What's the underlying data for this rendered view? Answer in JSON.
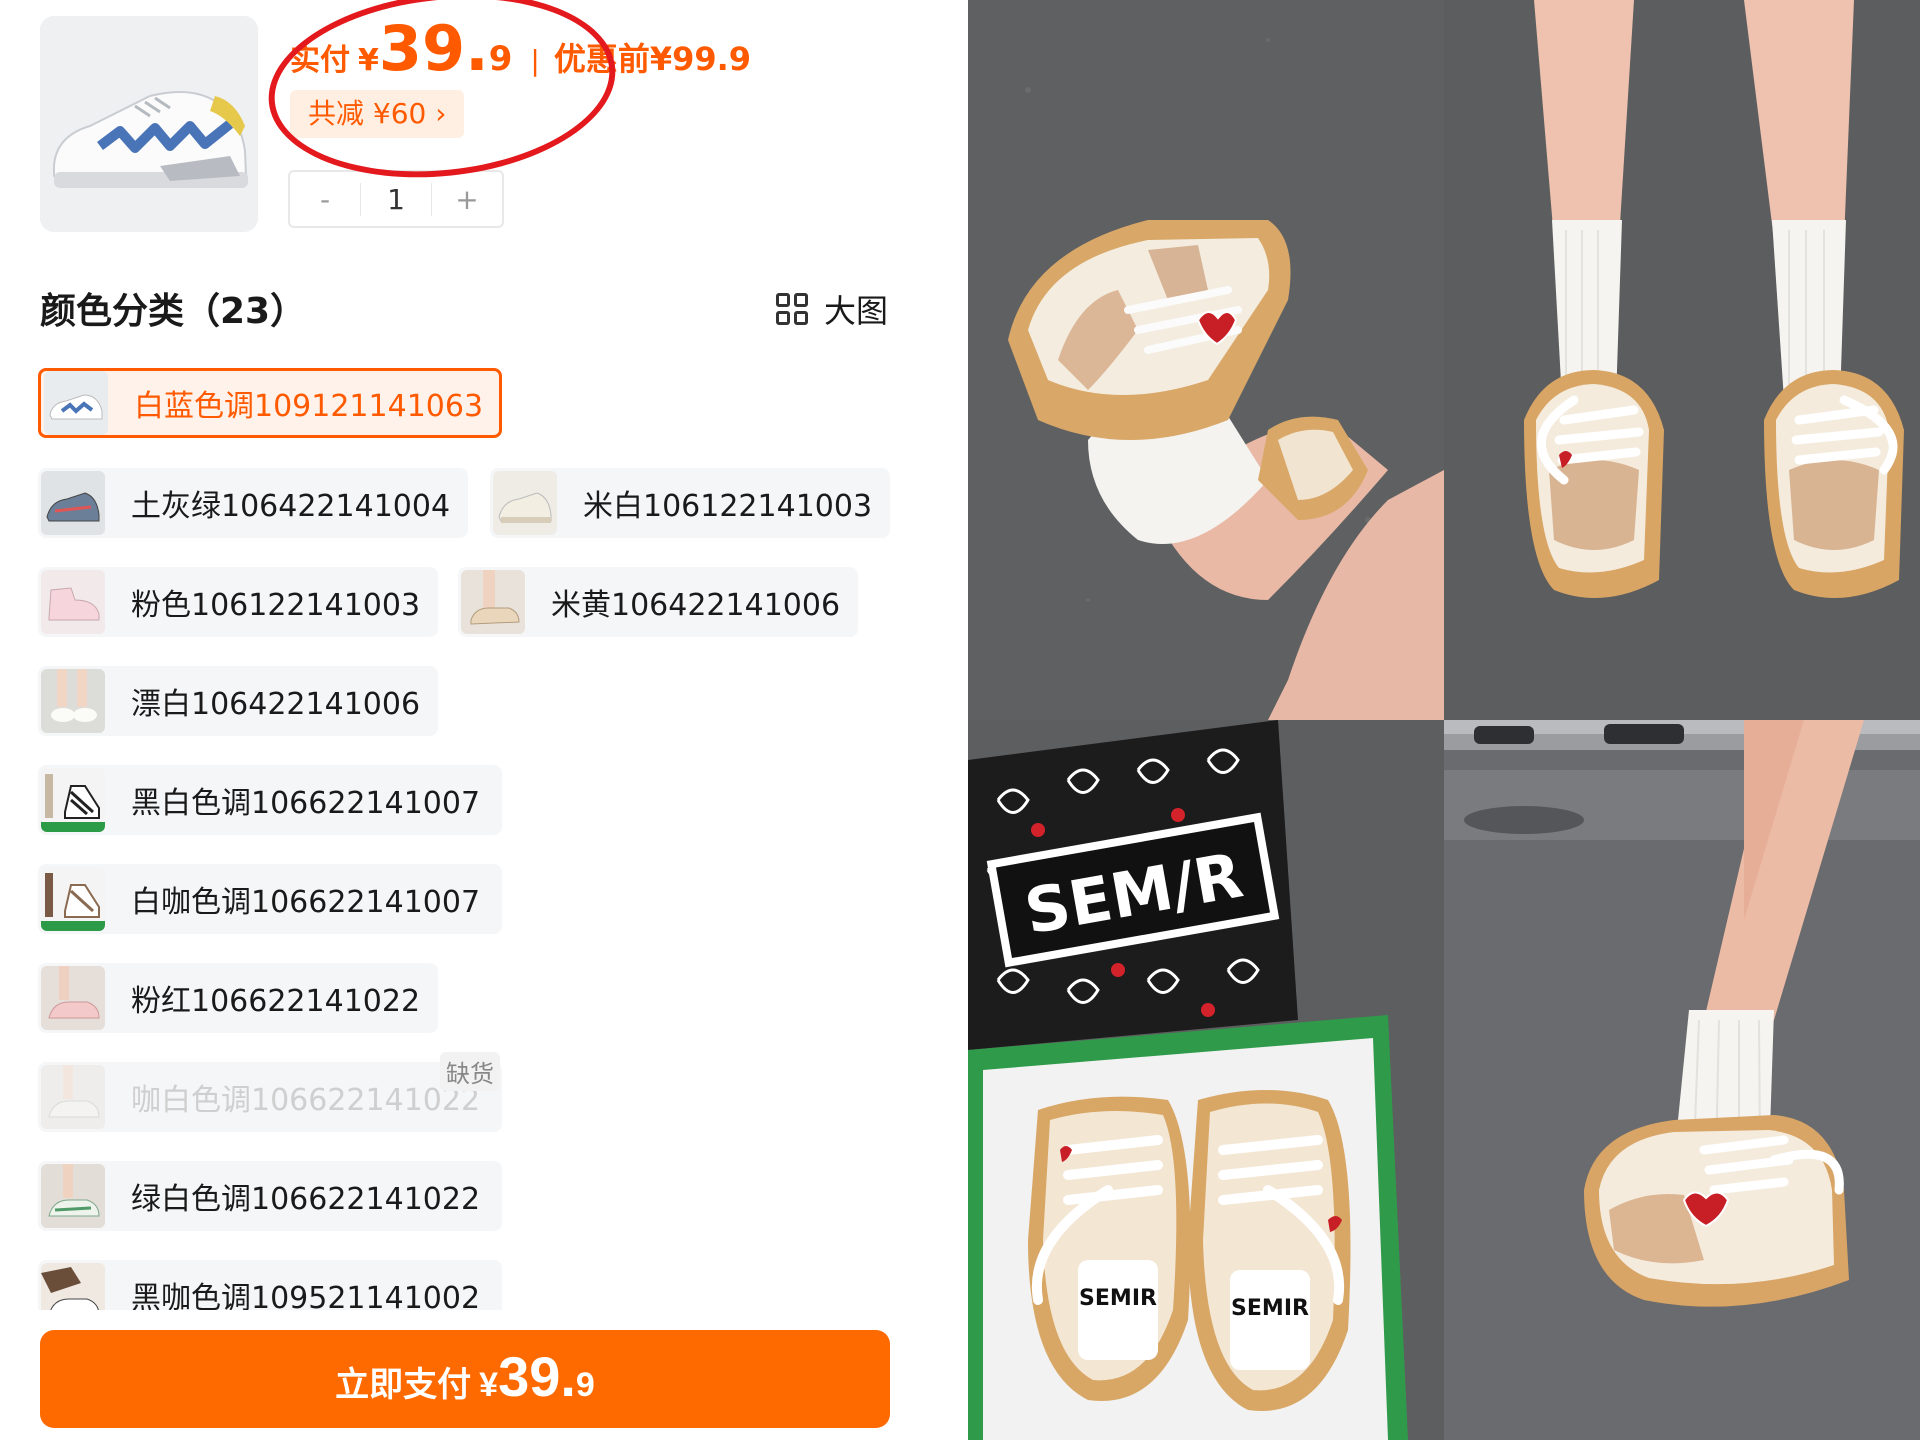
{
  "header": {
    "paid_label": "实付",
    "currency": "¥",
    "price_int": "39.",
    "price_dec": "9",
    "separator": "|",
    "original_label": "优惠前¥99.9",
    "discount_chip": "共减 ¥60 ›",
    "quantity": "1",
    "qty_minus": "-",
    "qty_plus": "+"
  },
  "section": {
    "title": "颜色分类（23）",
    "big_view_label": "大图"
  },
  "variants": [
    {
      "label": "白蓝色调109121141063",
      "state": "selected"
    },
    {
      "label": "土灰绿106422141004",
      "state": "normal"
    },
    {
      "label": "米白106122141003",
      "state": "normal"
    },
    {
      "label": "粉色106122141003",
      "state": "normal"
    },
    {
      "label": "米黄106422141006",
      "state": "normal"
    },
    {
      "label": "漂白106422141006",
      "state": "normal"
    },
    {
      "label": "黑白色调106622141007",
      "state": "normal"
    },
    {
      "label": "白咖色调106622141007",
      "state": "normal"
    },
    {
      "label": "粉红106622141022",
      "state": "normal"
    },
    {
      "label": "咖白色调106622141022",
      "state": "out_of_stock"
    },
    {
      "label": "绿白色调106622141022",
      "state": "normal"
    },
    {
      "label": "黑咖色调109521141002",
      "state": "normal"
    }
  ],
  "out_of_stock_badge": "缺货",
  "pay_button": {
    "label": "立即支付",
    "currency": "¥",
    "price_int": "39.",
    "price_dec": "9"
  },
  "photos": {
    "box_logo": "SEM/R",
    "shoe_logo": "SEMIR"
  },
  "colors": {
    "accent": "#ff5a00",
    "button": "#ff6a00",
    "annotation_circle": "#e3191d"
  }
}
